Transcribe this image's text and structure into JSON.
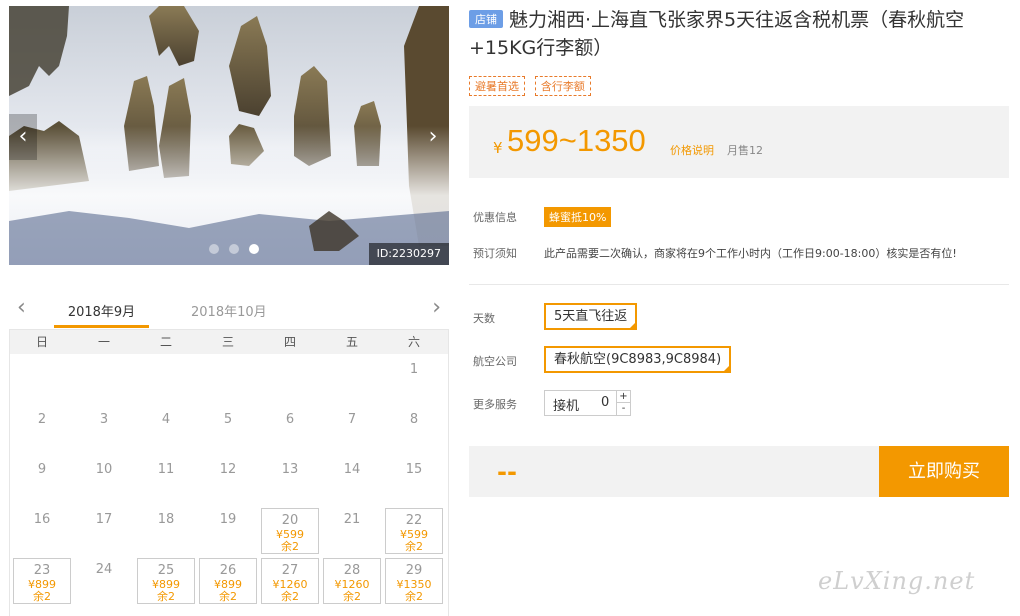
{
  "gallery": {
    "prev_glyph": "‹",
    "next_glyph": "›",
    "image_id": "ID:2230297",
    "dot_count": 3,
    "active_dot": 3
  },
  "calendar": {
    "prev_glyph": "‹",
    "next_glyph": "›",
    "tabs": [
      "2018年9月",
      "2018年10月"
    ],
    "active_tab": "2018年9月",
    "weekdays": [
      "日",
      "一",
      "二",
      "三",
      "四",
      "五",
      "六"
    ],
    "days": [
      {
        "day": "1",
        "weekday": 6
      },
      {
        "day": "2",
        "weekday": 0
      },
      {
        "day": "3",
        "weekday": 1
      },
      {
        "day": "4",
        "weekday": 2
      },
      {
        "day": "5",
        "weekday": 3
      },
      {
        "day": "6",
        "weekday": 4
      },
      {
        "day": "7",
        "weekday": 5
      },
      {
        "day": "8",
        "weekday": 6
      },
      {
        "day": "9",
        "weekday": 0
      },
      {
        "day": "10",
        "weekday": 1
      },
      {
        "day": "11",
        "weekday": 2
      },
      {
        "day": "12",
        "weekday": 3
      },
      {
        "day": "13",
        "weekday": 4
      },
      {
        "day": "14",
        "weekday": 5
      },
      {
        "day": "15",
        "weekday": 6
      },
      {
        "day": "16",
        "weekday": 0
      },
      {
        "day": "17",
        "weekday": 1
      },
      {
        "day": "18",
        "weekday": 2
      },
      {
        "day": "19",
        "weekday": 3
      },
      {
        "day": "20",
        "weekday": 4,
        "price": "¥599",
        "left": "余2"
      },
      {
        "day": "21",
        "weekday": 5
      },
      {
        "day": "22",
        "weekday": 6,
        "price": "¥599",
        "left": "余2"
      },
      {
        "day": "23",
        "weekday": 0,
        "price": "¥899",
        "left": "余2"
      },
      {
        "day": "24",
        "weekday": 1
      },
      {
        "day": "25",
        "weekday": 2,
        "price": "¥899",
        "left": "余2"
      },
      {
        "day": "26",
        "weekday": 3,
        "price": "¥899",
        "left": "余2"
      },
      {
        "day": "27",
        "weekday": 4,
        "price": "¥1260",
        "left": "余2"
      },
      {
        "day": "28",
        "weekday": 5,
        "price": "¥1260",
        "left": "余2"
      },
      {
        "day": "29",
        "weekday": 6,
        "price": "¥1350",
        "left": "余2"
      }
    ]
  },
  "product": {
    "shop_tag": "店铺",
    "title": "魅力湘西·上海直飞张家界5天往返含税机票（春秋航空+15KG行李额）",
    "chips": [
      "避暑首选",
      "含行李额"
    ],
    "currency": "¥",
    "price_range": "599~1350",
    "price_explain": "价格说明",
    "sold": "月售12"
  },
  "info": {
    "promo_label": "优惠信息",
    "promo_badge": "蜂蜜抵10%",
    "notice_label": "预订须知",
    "notice_text": "此产品需要二次确认，商家将在9个工作小时内（工作日9:00-18:00）核实是否有位!"
  },
  "options": {
    "days_label": "天数",
    "days_value": "5天直飞往返",
    "airline_label": "航空公司",
    "airline_value": "春秋航空(9C8983,9C8984)",
    "service_label": "更多服务",
    "service_name": "接机",
    "service_qty": "0",
    "plus": "+",
    "minus": "-"
  },
  "purchase": {
    "total": "--",
    "buy_label": "立即购买"
  },
  "watermark": "eLvXing.net",
  "colors": {
    "accent": "#f39800",
    "shop_tag": "#6d9ee6",
    "panel": "#f2f2f2"
  }
}
